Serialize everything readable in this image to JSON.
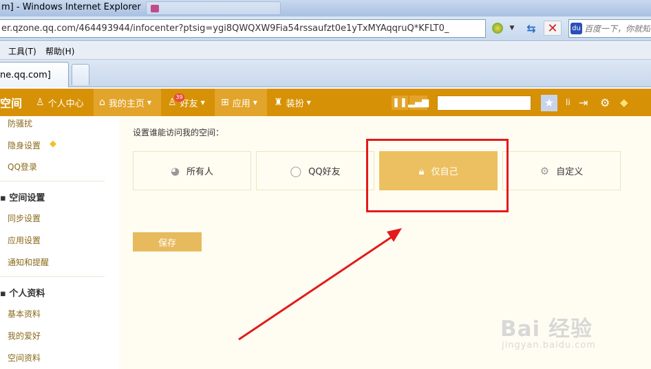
{
  "window": {
    "title": "m] - Windows Internet Explorer"
  },
  "address_bar": {
    "url": "er.qzone.qq.com/464493944/infocenter?ptsig=ygi8QWQXW9Fia54rssaufzt0e1yTxMYAqqruQ*KFLT0_"
  },
  "search_box": {
    "placeholder": "百度一下，你就知"
  },
  "menubar": {
    "tools": "工具(T)",
    "help": "帮助(H)"
  },
  "tab": {
    "active_label": "ne.qq.com]"
  },
  "qzone_nav": {
    "logo": "空间",
    "personal_center": "个人中心",
    "my_home": "我的主页",
    "friends": "好友",
    "friends_badge": "39",
    "apps": "应用",
    "dress_up": "装扮",
    "username": "li"
  },
  "sidebar": {
    "items_top": [
      "防骚扰",
      "隐身设置",
      "QQ登录"
    ],
    "section_space_settings": "空间设置",
    "items_space": [
      "同步设置",
      "应用设置",
      "通知和提醒"
    ],
    "section_profile": "个人资料",
    "items_profile": [
      "基本资料",
      "我的爱好",
      "空间资料"
    ]
  },
  "settings": {
    "who_can_access_label": "设置谁能访问我的空间：",
    "options": [
      "所有人",
      "QQ好友",
      "仅自己",
      "自定义"
    ],
    "selected": "仅自己",
    "save_label": "保存"
  },
  "watermark": {
    "brand": "Bai 经验",
    "site": "jingyan.baidu.com"
  },
  "colors": {
    "nav_bg": "#d79106",
    "selected_option": "#ecc060",
    "annotation_red": "#e21a1a"
  }
}
